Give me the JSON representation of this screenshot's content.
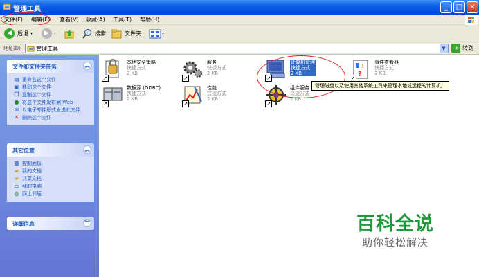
{
  "window": {
    "title": "管理工具",
    "buttons": {
      "minimize": "_",
      "maximize": "□",
      "close": "✕"
    }
  },
  "menu": [
    {
      "label": "文件(F)"
    },
    {
      "label": "编辑(E)"
    },
    {
      "label": "查看(V)"
    },
    {
      "label": "收藏(A)"
    },
    {
      "label": "工具(T)"
    },
    {
      "label": "帮助(H)"
    }
  ],
  "toolbar": {
    "back": "后退",
    "search": "搜索",
    "folders": "文件夹"
  },
  "address": {
    "label": "地址(D)",
    "value": "管理工具",
    "go": "转到"
  },
  "sidebar": {
    "tasks": {
      "title": "文件和文件夹任务",
      "items": [
        {
          "label": "重命名这个文件",
          "icon": "rename-icon"
        },
        {
          "label": "移动这个文件",
          "icon": "move-icon"
        },
        {
          "label": "复制这个文件",
          "icon": "copy-icon"
        },
        {
          "label": "将这个文件发布到 Web",
          "icon": "web-publish-icon"
        },
        {
          "label": "以电子邮件形式发送此文件",
          "icon": "email-icon"
        },
        {
          "label": "删除这个文件",
          "icon": "delete-icon"
        }
      ]
    },
    "places": {
      "title": "其它位置",
      "items": [
        {
          "label": "控制面板",
          "icon": "control-panel-icon"
        },
        {
          "label": "我的文档",
          "icon": "my-documents-icon"
        },
        {
          "label": "共享文档",
          "icon": "shared-documents-icon"
        },
        {
          "label": "我的电脑",
          "icon": "my-computer-icon"
        },
        {
          "label": "网上邻居",
          "icon": "network-icon"
        }
      ]
    },
    "details": {
      "title": "详细信息"
    }
  },
  "files": [
    {
      "name": "本地安全策略",
      "kind": "快捷方式",
      "size": "2 KB",
      "icon": "security-policy-icon",
      "selected": false
    },
    {
      "name": "服务",
      "kind": "快捷方式",
      "size": "2 KB",
      "icon": "services-gears-icon",
      "selected": false
    },
    {
      "name": "计算机管理",
      "kind": "快捷方式",
      "size": "2 KB",
      "icon": "computer-management-icon",
      "selected": true
    },
    {
      "name": "事件查看器",
      "kind": "快捷方式",
      "size": "2 KB",
      "icon": "event-viewer-icon",
      "selected": false
    },
    {
      "name": "数据源 (ODBC)",
      "kind": "快捷方式",
      "size": "2 KB",
      "icon": "odbc-icon",
      "selected": false
    },
    {
      "name": "性能",
      "kind": "快捷方式",
      "size": "2 KB",
      "icon": "performance-icon",
      "selected": false
    },
    {
      "name": "组件服务",
      "kind": "快捷方式",
      "size": "2 KB",
      "icon": "component-services-icon",
      "selected": false
    }
  ],
  "tooltip": "管理磁盘以及使用其他系统工具来管理本地或远程的计算机。",
  "watermark": {
    "main": "百科全说",
    "sub": "助你轻松解决"
  },
  "colors": {
    "titlebar": "#0a5fe6",
    "sidebar": "#7ba2e7",
    "selection": "#316ac5",
    "annotation": "#dd2222",
    "watermark": "#1d9a3c"
  }
}
